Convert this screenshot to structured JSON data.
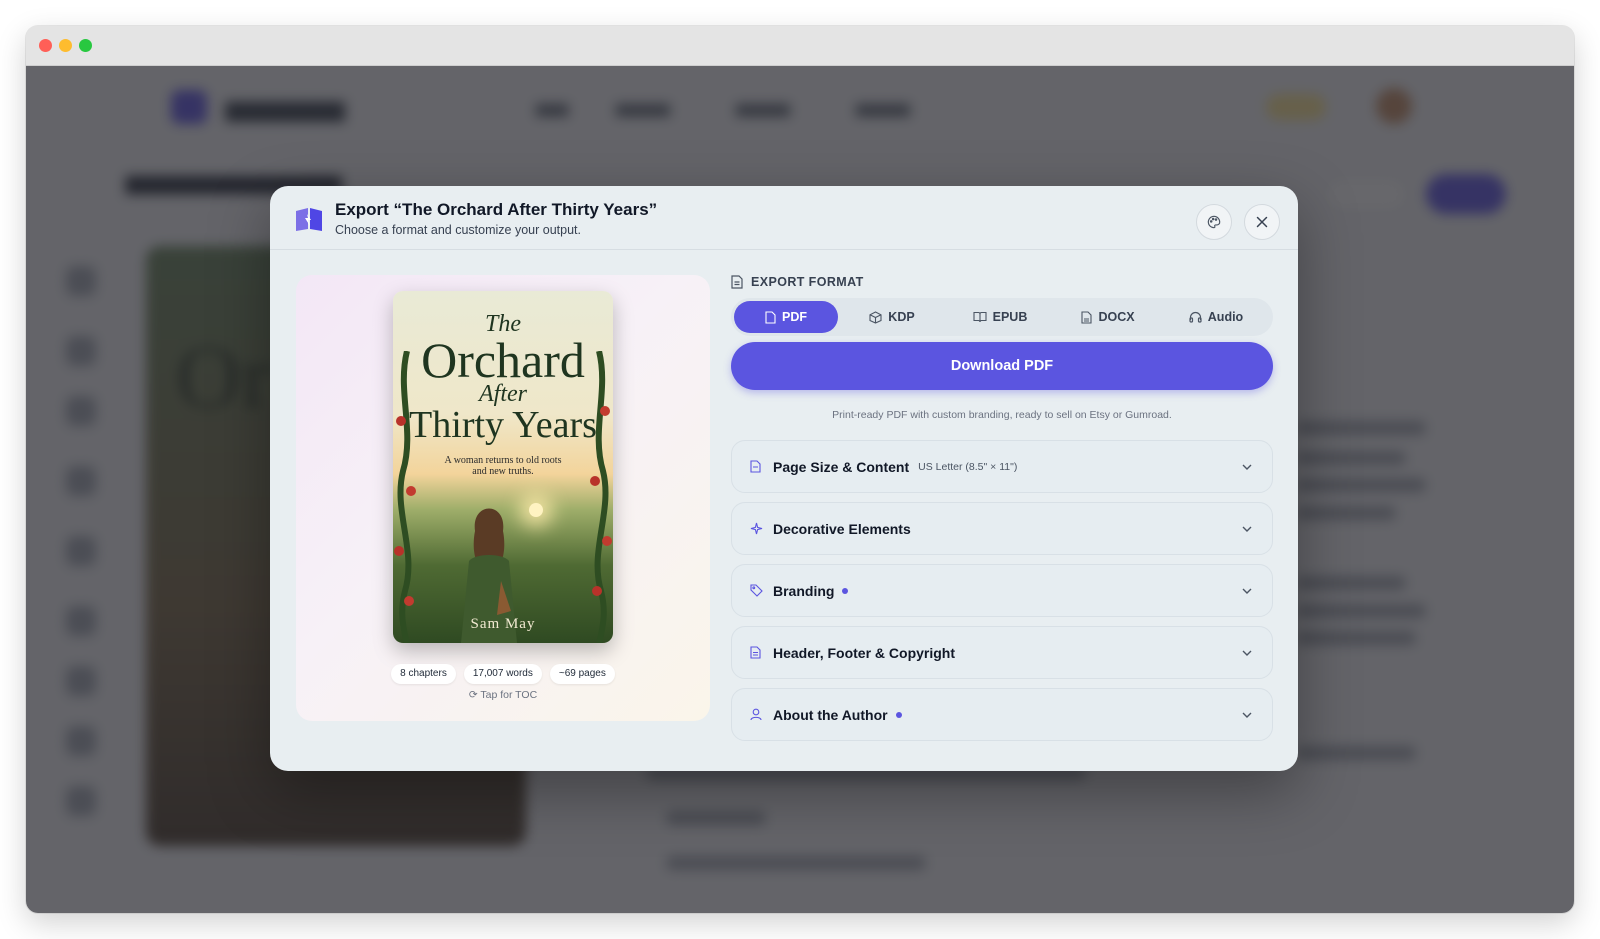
{
  "modal": {
    "title": "Export “The Orchard After Thirty Years”",
    "subtitle": "Choose a format and customize your output."
  },
  "cover": {
    "title_the": "The",
    "title_orchard": "Orchard",
    "title_after": "After",
    "title_thirty": "Thirty Years",
    "tagline": "A woman returns to old roots and new truths.",
    "author": "Sam May"
  },
  "stats": {
    "chapters": "8 chapters",
    "words": "17,007 words",
    "pages": "~69 pages"
  },
  "toc_label": "Tap for TOC",
  "export_format": {
    "label": "EXPORT FORMAT",
    "tabs": [
      "PDF",
      "KDP",
      "EPUB",
      "DOCX",
      "Audio"
    ],
    "selected": "PDF"
  },
  "download_label": "Download PDF",
  "description": "Print-ready PDF with custom branding, ready to sell on Etsy or Gumroad.",
  "sections": [
    {
      "title": "Page Size & Content",
      "subtitle": "US Letter (8.5\" × 11\")",
      "icon": "document-icon",
      "dot": false
    },
    {
      "title": "Decorative Elements",
      "subtitle": "",
      "icon": "sparkle-icon",
      "dot": false
    },
    {
      "title": "Branding",
      "subtitle": "",
      "icon": "tag-icon",
      "dot": true
    },
    {
      "title": "Header, Footer & Copyright",
      "subtitle": "",
      "icon": "file-text-icon",
      "dot": false
    },
    {
      "title": "About the Author",
      "subtitle": "",
      "icon": "user-icon",
      "dot": true
    }
  ],
  "colors": {
    "accent": "#5b55e0",
    "modal_bg": "#e8eef1"
  }
}
